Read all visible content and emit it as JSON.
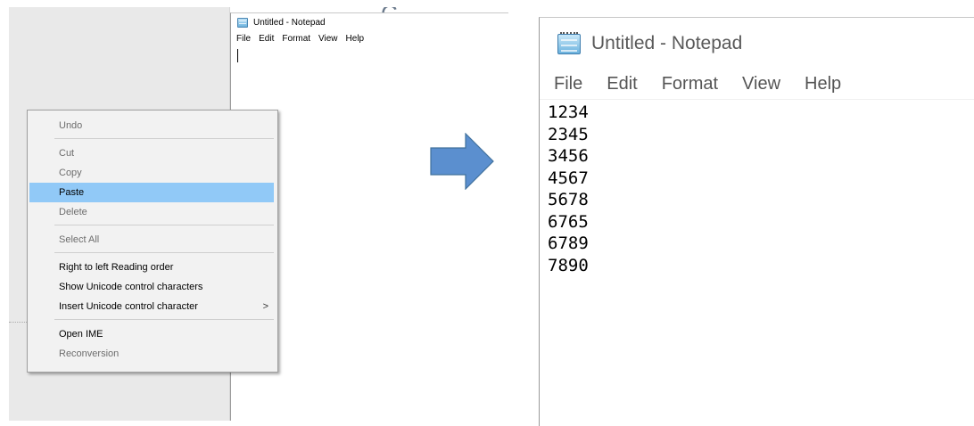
{
  "left_window": {
    "title": "Untitled - Notepad",
    "menu": [
      "File",
      "Edit",
      "Format",
      "View",
      "Help"
    ],
    "background_fragment": "C"
  },
  "context_menu": {
    "items": [
      {
        "label": "Undo",
        "disabled": true
      },
      {
        "label": "Cut",
        "disabled": true
      },
      {
        "label": "Copy",
        "disabled": true
      },
      {
        "label": "Paste",
        "disabled": false,
        "highlighted": true
      },
      {
        "label": "Delete",
        "disabled": true
      },
      {
        "label": "Select All",
        "disabled": true
      },
      {
        "label": "Right to left Reading order",
        "disabled": false
      },
      {
        "label": "Show Unicode control characters",
        "disabled": false
      },
      {
        "label": "Insert Unicode control character",
        "disabled": false,
        "submenu_arrow": ">"
      },
      {
        "label": "Open IME",
        "disabled": false
      },
      {
        "label": "Reconversion",
        "disabled": true
      }
    ],
    "highlight_color": "#91c9f7"
  },
  "arrow": {
    "color": "#5b8fcf",
    "icon": "right-arrow-icon"
  },
  "right_window": {
    "title": "Untitled - Notepad",
    "menu": [
      "File",
      "Edit",
      "Format",
      "View",
      "Help"
    ],
    "lines": [
      "1234",
      "2345",
      "3456",
      "4567",
      "5678",
      "6765",
      "6789",
      "7890"
    ]
  }
}
